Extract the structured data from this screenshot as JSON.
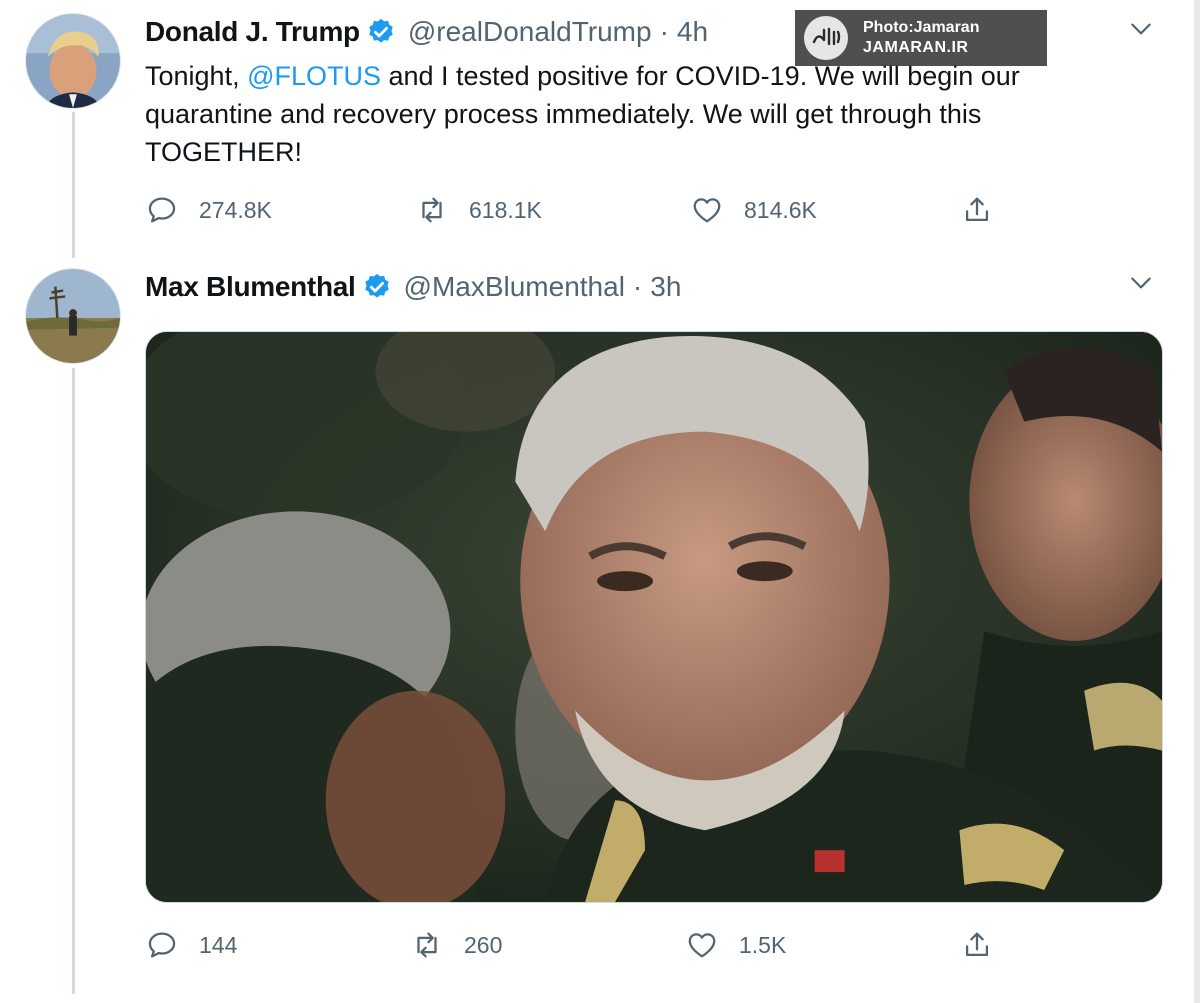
{
  "tweets": [
    {
      "name": "Donald J. Trump",
      "handle": "@realDonaldTrump",
      "separator": "·",
      "time": "4h",
      "text_before": "Tonight, ",
      "mention": "@FLOTUS",
      "text_after": " and I tested positive for COVID-19. We will begin our quarantine and recovery process immediately. We will get through this TOGETHER!",
      "stats": {
        "replies": "274.8K",
        "retweets": "618.1K",
        "likes": "814.6K"
      }
    },
    {
      "name": "Max Blumenthal",
      "handle": "@MaxBlumenthal",
      "separator": "·",
      "time": "3h",
      "stats": {
        "replies": "144",
        "retweets": "260",
        "likes": "1.5K"
      }
    }
  ],
  "watermark": {
    "line1": "Photo:Jamaran",
    "line2": "JAMARAN.IR"
  },
  "icons": {
    "verified": "verified-badge-icon",
    "caret": "chevron-down-icon",
    "reply": "reply-icon",
    "retweet": "retweet-icon",
    "like": "like-icon",
    "share": "share-icon"
  },
  "colors": {
    "accent": "#1d9bf0",
    "text": "#0f1419",
    "muted": "#536471"
  }
}
